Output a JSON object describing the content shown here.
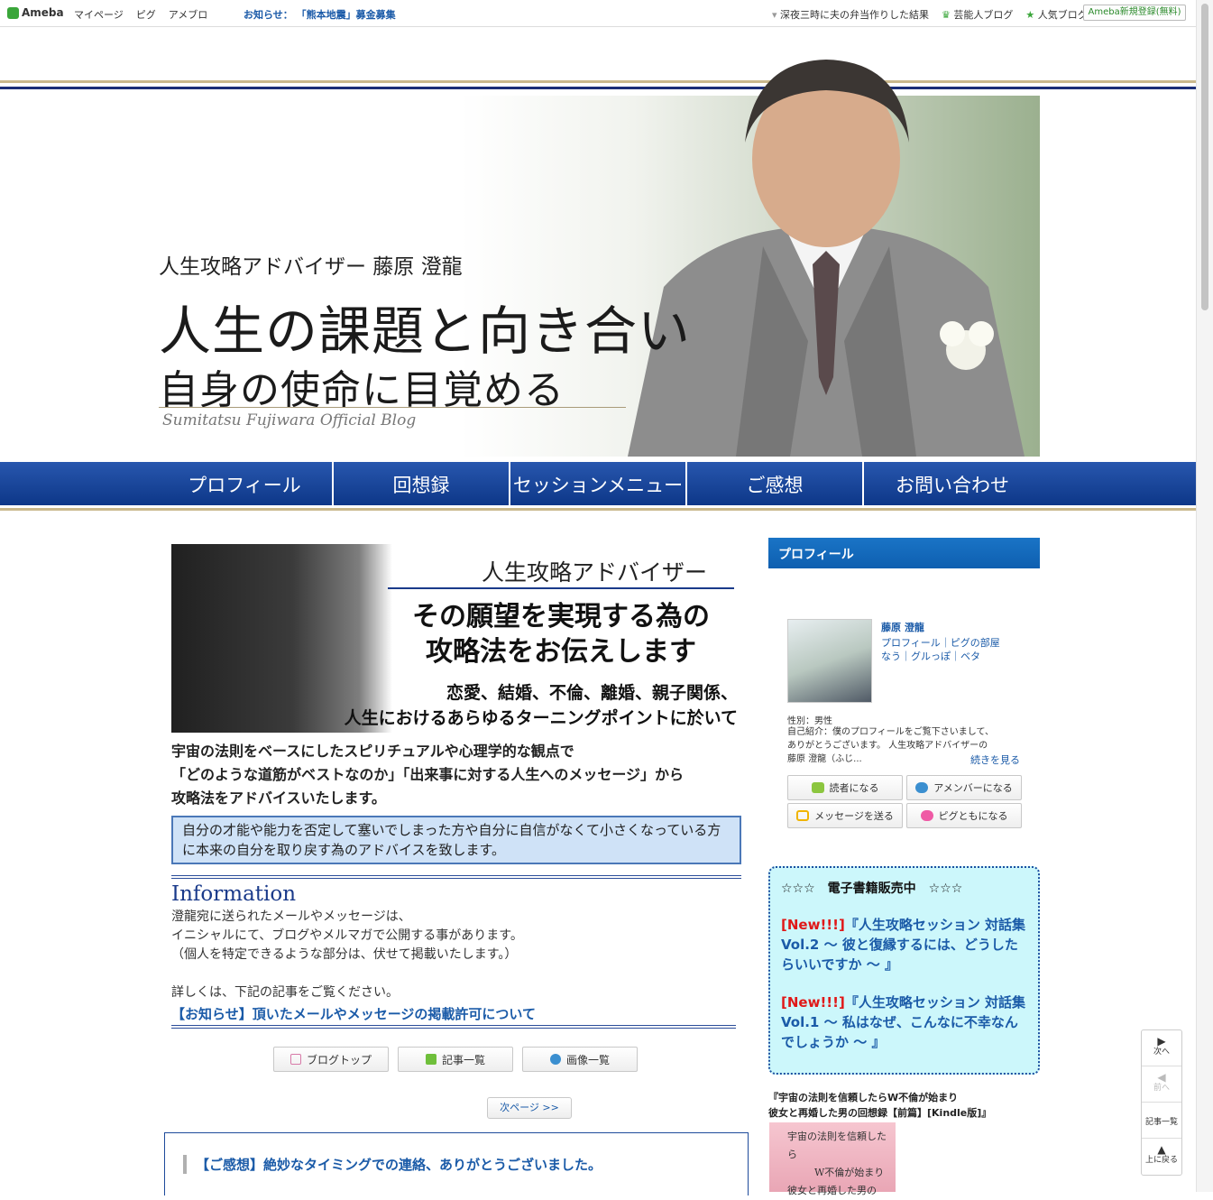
{
  "topbar": {
    "logo": "Ameba",
    "nav": [
      "マイページ",
      "ピグ",
      "アメブロ"
    ],
    "notice_label": "お知らせ：",
    "notice_link": "「熊本地震」募金募集",
    "right": [
      "深夜三時に夫の弁当作りした結果",
      "芸能人ブログ",
      "人気ブログ"
    ],
    "register": "Ameba新規登録(無料)"
  },
  "hero": {
    "tagline": "人生攻略アドバイザー 藤原 澄龍",
    "headline1": "人生の課題と向き合い",
    "headline2": "自身の使命に目覚める",
    "subtitle": "Sumitatsu Fujiwara Official Blog"
  },
  "gnav": [
    "プロフィール",
    "回想録",
    "セッションメニュー",
    "ご感想",
    "お問い合わせ"
  ],
  "banner": {
    "t1": "人生攻略アドバイザー",
    "t2": "その願望を実現する為の",
    "t3": "攻略法をお伝えします",
    "t4": "恋愛、結婚、不倫、離婚、親子関係、",
    "t5": "人生におけるあらゆるターニングポイントに於いて"
  },
  "intro": [
    "宇宙の法則をベースにしたスピリチュアルや心理学的な観点で",
    "「どのような道筋がベストなのか」「出来事に対する人生へのメッセージ」から",
    "攻略法をアドバイスいたします。"
  ],
  "box": "自分の才能や能力を否定して塞いでしまった方や自分に自信がなくて小さくなっている方に本来の自分を取り戻す為のアドバイスを致します。",
  "information": {
    "title": "Information",
    "lines": [
      "澄龍宛に送られたメールやメッセージは、",
      "イニシャルにて、ブログやメルマガで公開する事があります。",
      "（個人を特定できるような部分は、伏せて掲載いたします。）",
      "",
      "詳しくは、下記の記事をご覧ください。"
    ],
    "link": "【お知らせ】頂いたメールやメッセージの掲載許可について"
  },
  "tools": [
    "ブログトップ",
    "記事一覧",
    "画像一覧"
  ],
  "next_page": "次ページ >>",
  "article_title": "【ご感想】絶妙なタイミングでの連絡、ありがとうございました。",
  "sidebar": {
    "profile_head": "プロフィール",
    "name": "藤原 澄龍",
    "links1": "プロフィール｜ピグの部屋",
    "links2": "なう｜グルっぽ｜ベタ",
    "gender": "性別：男性",
    "intro_line1": "自己紹介：僕のプロフィールをご覧下さいまして、",
    "intro_line2": "ありがとうございます。 人生攻略アドバイザーの",
    "intro_line3": "藤原 澄龍（ふじ...",
    "more": "続きを見る",
    "buttons": [
      "読者になる",
      "アメンバーになる",
      "メッセージを送る",
      "ピグともになる"
    ]
  },
  "ebook": {
    "head": "☆☆☆　電子書籍販売中　☆☆☆",
    "items": [
      {
        "new": "[New!!!]",
        "text": "『人生攻略セッション 対話集 Vol.2 〜 彼と復縁するには、どうしたらいいですか 〜 』"
      },
      {
        "new": "[New!!!]",
        "text": "『人生攻略セッション 対話集 Vol.1 〜 私はなぜ、こんなに不幸なんでしょうか 〜 』"
      }
    ]
  },
  "kindle": {
    "line1": "『宇宙の法則を信頼したらW不倫が始まり",
    "line2": "彼女と再婚した男の回想録【前篇】[Kindle版]』",
    "cover1": "宇宙の法則を信頼したら",
    "cover2": "W不倫が始まり",
    "cover3": "彼女と再婚した男の"
  },
  "pager": [
    "次へ",
    "前へ",
    "記事一覧",
    "上に戻る"
  ],
  "colors": {
    "nav_blue": "#0d3788",
    "link_blue": "#1b5ba8",
    "gold": "#c9b88c",
    "ebook_bg": "#ccf7fb"
  }
}
